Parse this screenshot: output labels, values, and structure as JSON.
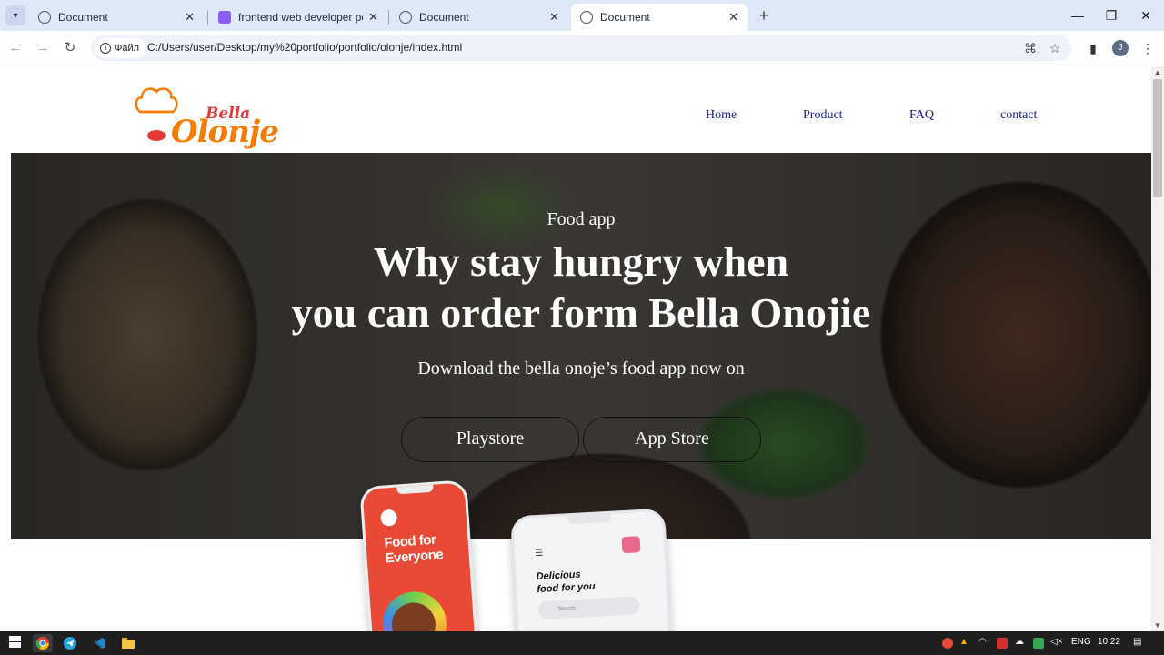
{
  "browser": {
    "tabs": [
      {
        "title": "Document",
        "active": false
      },
      {
        "title": "frontend web developer portfo",
        "active": false
      },
      {
        "title": "Document",
        "active": false
      },
      {
        "title": "Document",
        "active": true
      }
    ],
    "site_chip": "Файл",
    "url": "C:/Users/user/Desktop/my%20portfolio/portfolio/olonje/index.html",
    "profile_initial": "J"
  },
  "page": {
    "logo": {
      "small": "Bella",
      "big": "Olonje"
    },
    "nav": [
      "Home",
      "Product",
      "FAQ",
      "contact"
    ],
    "hero": {
      "subtitle": "Food app",
      "headline_line1": "Why stay hungry when",
      "headline_line2": "you can order form Bella Onojie",
      "download_text": "Download the bella onoje’s food app now on",
      "buttons": [
        "Playstore",
        "App Store"
      ]
    },
    "phone1": {
      "title_line1": "Food for",
      "title_line2": "Everyone"
    },
    "phone2": {
      "title_line1": "Delicious",
      "title_line2": "food for you",
      "search_placeholder": "Search"
    }
  },
  "taskbar": {
    "language": "ENG",
    "time": "10:22"
  },
  "colors": {
    "nav_link": "#1a1aa6",
    "logo_orange": "#f57c00",
    "logo_red": "#e53935",
    "tabbar": "#dfe8f7"
  }
}
